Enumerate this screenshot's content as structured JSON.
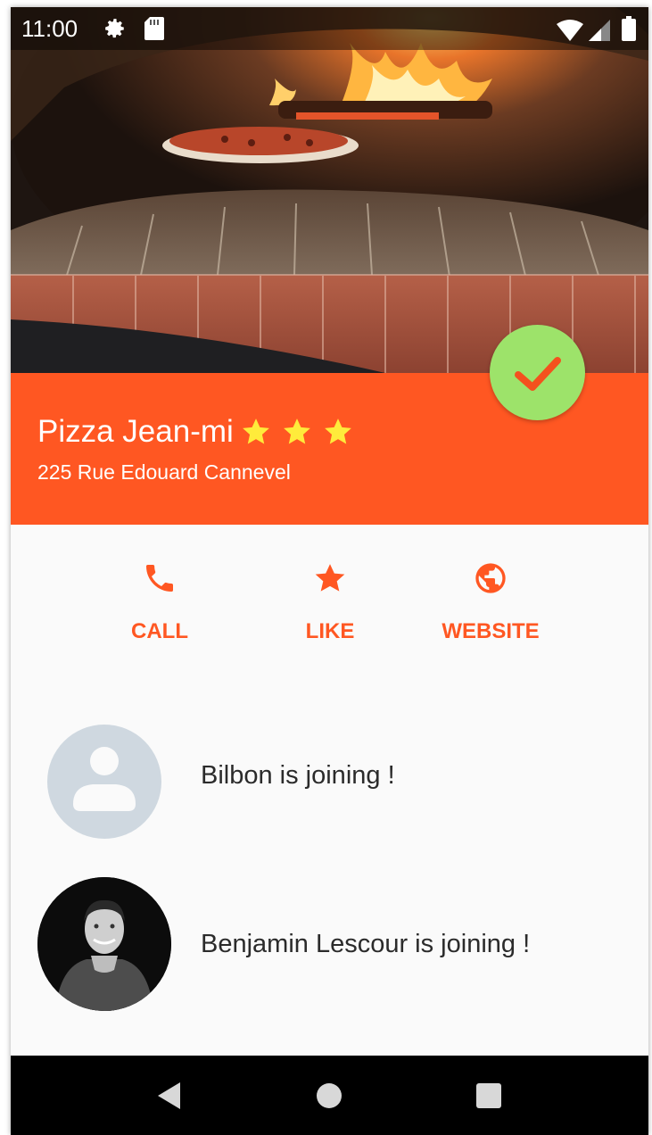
{
  "status_bar": {
    "time": "11:00",
    "icons": [
      "gear-icon",
      "sd-card-icon",
      "wifi-icon",
      "signal-icon",
      "battery-icon"
    ]
  },
  "restaurant": {
    "name": "Pizza Jean-mi",
    "rating": 3,
    "address": "225 Rue Edouard Cannevel",
    "joined": true
  },
  "actions": [
    {
      "label": "CALL",
      "icon": "phone-icon"
    },
    {
      "label": "LIKE",
      "icon": "star-icon"
    },
    {
      "label": "WEBSITE",
      "icon": "globe-icon"
    }
  ],
  "joiners": [
    {
      "text": "Bilbon  is joining !",
      "avatar": "default-avatar"
    },
    {
      "text": "Benjamin Lescour  is joining !",
      "avatar": "photo-avatar"
    }
  ],
  "colors": {
    "primary": "#ff5722",
    "star": "#ffeb3b",
    "check_fab": "#9de36a",
    "background": "#fafafa"
  }
}
